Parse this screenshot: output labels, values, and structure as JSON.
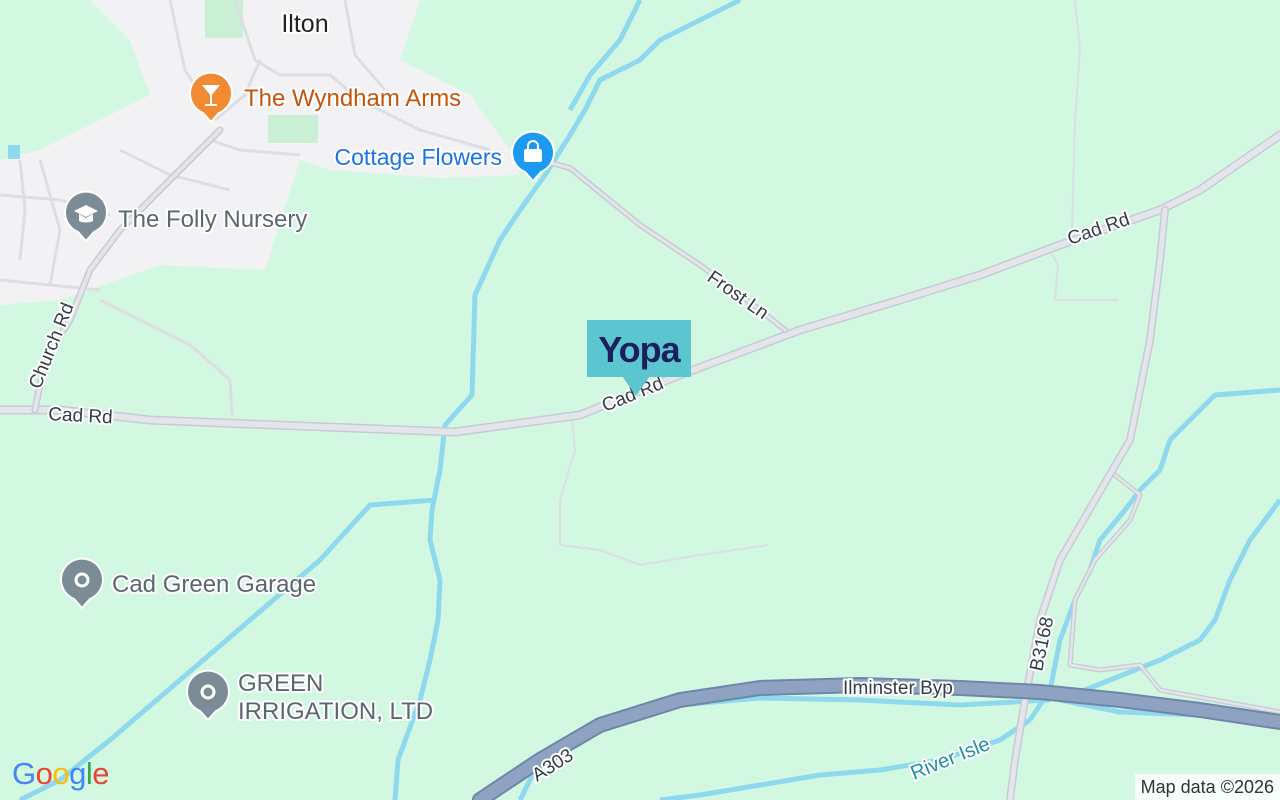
{
  "map": {
    "place": "Ilton",
    "roads": {
      "cad_rd_west": "Cad Rd",
      "cad_rd_mid": "Cad Rd",
      "cad_rd_east": "Cad Rd",
      "church_rd": "Church Rd",
      "frost_ln": "Frost Ln",
      "b3168": "B3168",
      "ilminster_byp": "Ilminster Byp",
      "a303": "A303"
    },
    "river": "River Isle",
    "pois": [
      {
        "name": "The Wyndham Arms",
        "icon": "cocktail-icon",
        "color": "#f18a32"
      },
      {
        "name": "Cottage Flowers",
        "icon": "shopping-bag-icon",
        "color": "#1a9af0"
      },
      {
        "name": "The Folly Nursery",
        "icon": "graduation-cap-icon",
        "color": "#7b8c97"
      },
      {
        "name": "Cad Green Garage",
        "icon": "pin-dot-icon",
        "color": "#7b8c97"
      },
      {
        "name": "GREEN",
        "name_line2": "IRRIGATION, LTD",
        "icon": "pin-dot-icon",
        "color": "#7b8c97"
      }
    ],
    "marker": {
      "label": "Yopa",
      "color": "#5bc6d0",
      "text_color": "#1b1f5c"
    }
  },
  "attribution": "Map data ©2026",
  "logo": {
    "letters": [
      "G",
      "o",
      "o",
      "g",
      "l",
      "e"
    ]
  },
  "colors": {
    "land": "#d3f8e2",
    "urban": "#f2f2f4",
    "water": "#8fd9ef",
    "road": "#dcdee6",
    "motorway": "#8ea3c2"
  }
}
